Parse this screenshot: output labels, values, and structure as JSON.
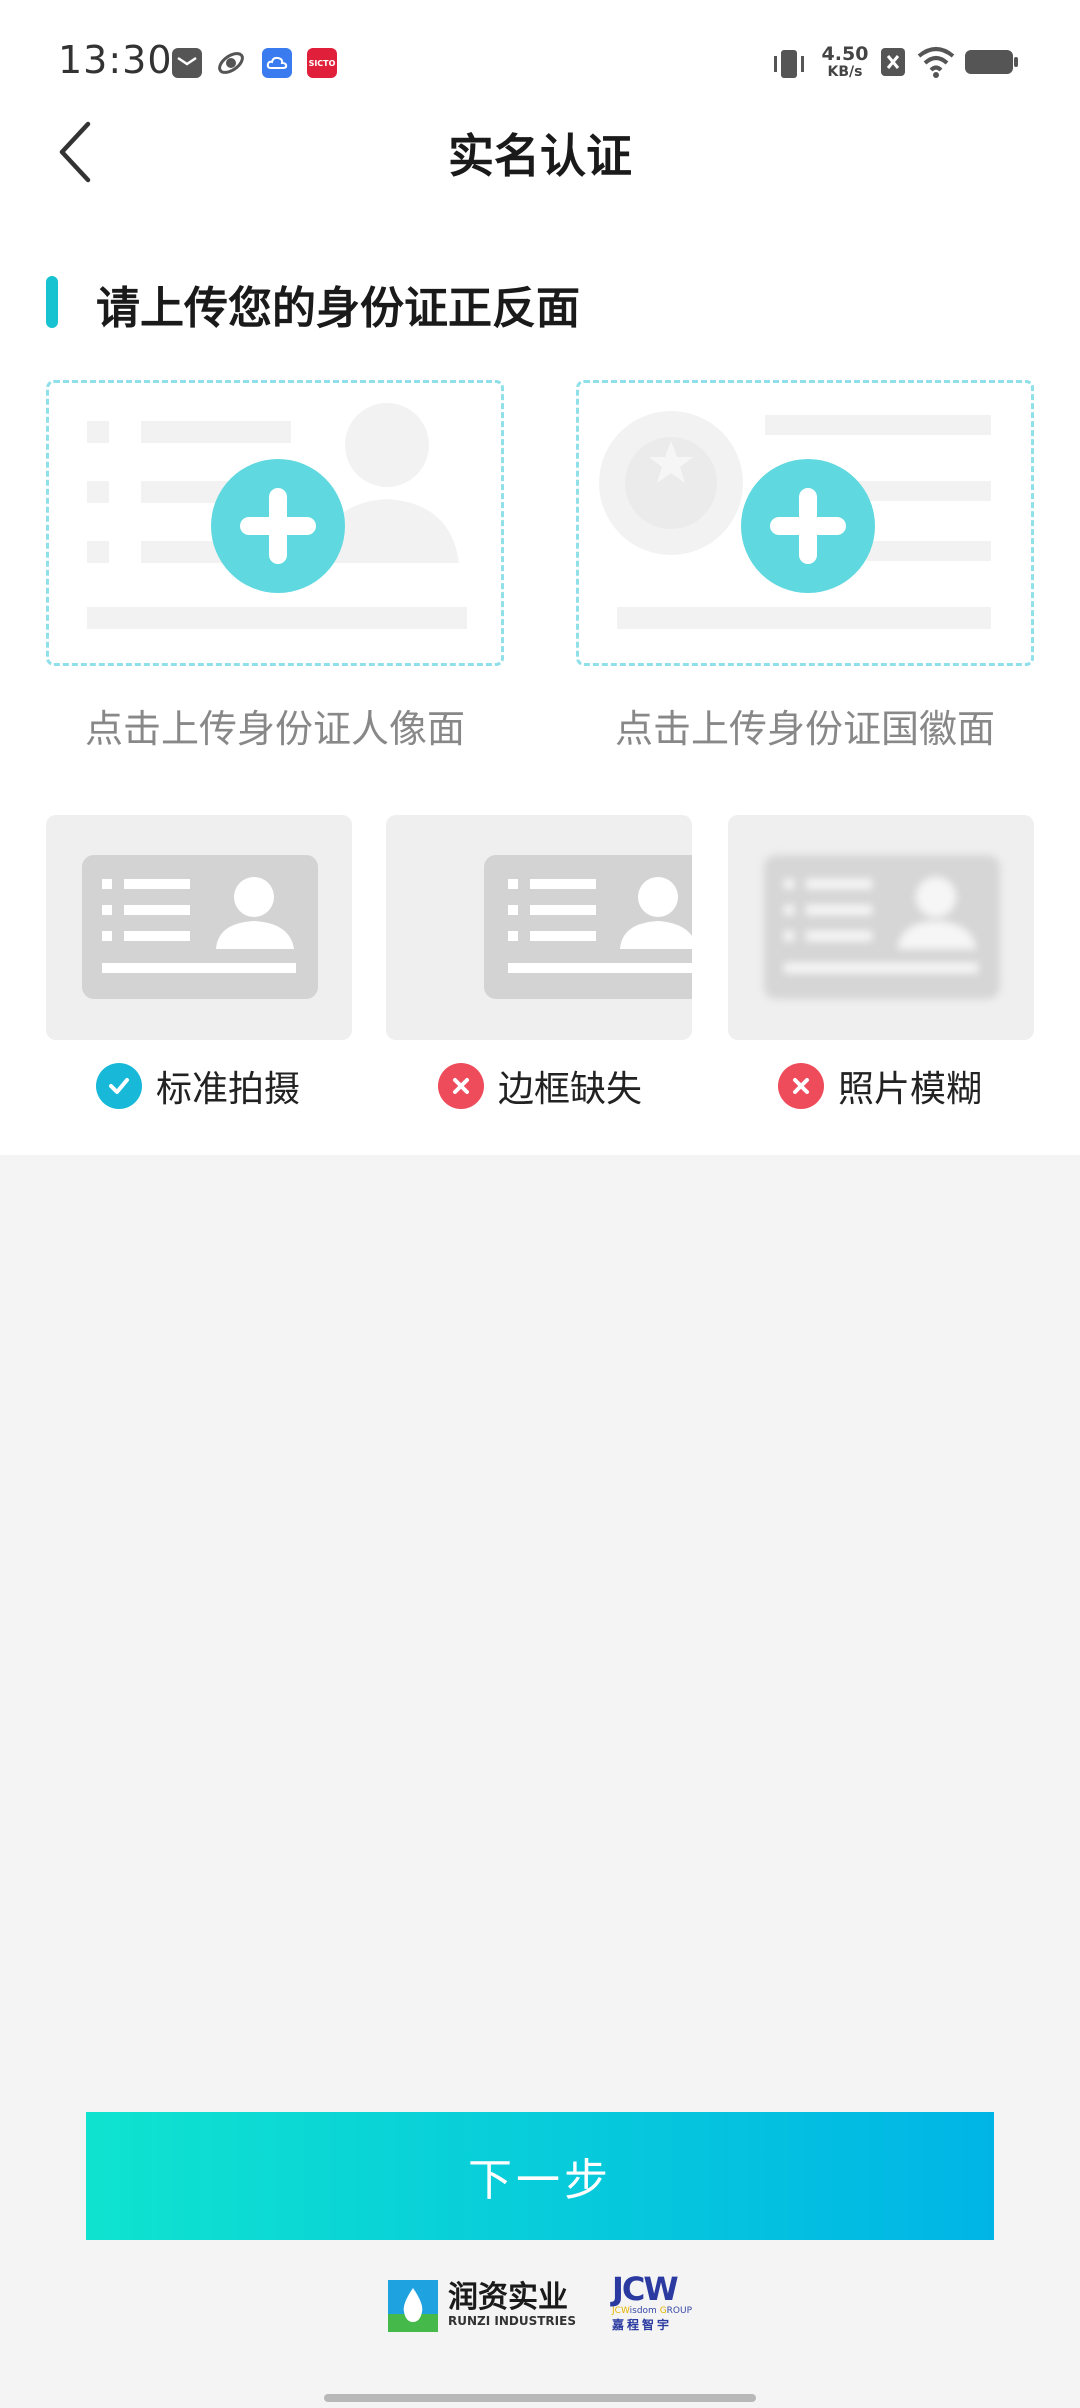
{
  "status_bar": {
    "time": "13:30",
    "net_speed_value": "4.50",
    "net_speed_unit": "KB/s",
    "app_icons": [
      "mail-app-icon",
      "orbit-app-icon",
      "cloud-app-icon",
      "sicto-app-icon"
    ],
    "sicto_label": "SICTO"
  },
  "header": {
    "title": "实名认证",
    "back_icon": "chevron-left-icon"
  },
  "section": {
    "title": "请上传您的身份证正反面",
    "accent_color": "#17c3d0"
  },
  "uploads": [
    {
      "caption": "点击上传身份证人像面",
      "icon": "plus-icon"
    },
    {
      "caption": "点击上传身份证国徽面",
      "icon": "plus-icon"
    }
  ],
  "examples": [
    {
      "label": "标准拍摄",
      "status": "ok",
      "icon": "check-icon",
      "color": "#17b8d8"
    },
    {
      "label": "边框缺失",
      "status": "error",
      "icon": "cross-icon",
      "color": "#ee4b5b"
    },
    {
      "label": "照片模糊",
      "status": "error",
      "icon": "cross-icon",
      "color": "#ee4b5b"
    }
  ],
  "next_button": {
    "label": "下一步",
    "gradient_start": "#0fe3cf",
    "gradient_end": "#00b5e6"
  },
  "footer": {
    "logo1_cn": "润资实业",
    "logo1_en": "RUNZI INDUSTRIES",
    "logo2_mark": "JCW",
    "logo2_en_a": "JCW",
    "logo2_en_b": "isdom ",
    "logo2_en_c": "G",
    "logo2_en_d": "ROUP",
    "logo2_cn": "嘉程智宇"
  }
}
